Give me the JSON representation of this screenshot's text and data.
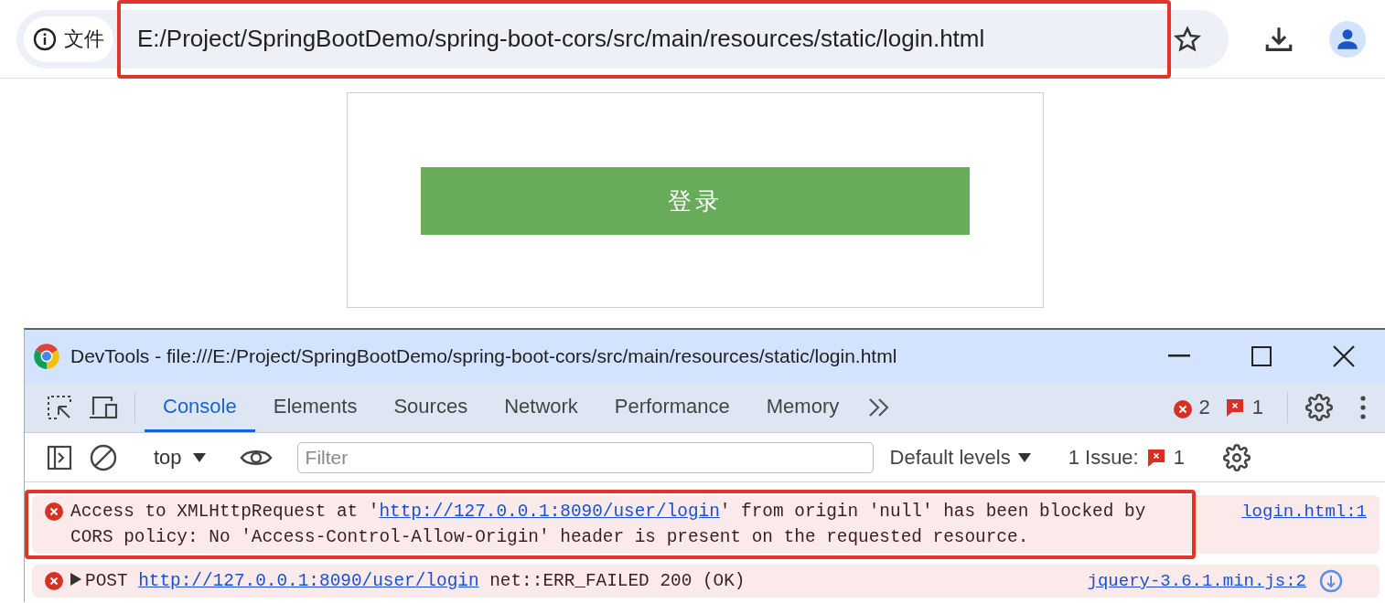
{
  "browser": {
    "site_label": "文件",
    "url": "E:/Project/SpringBootDemo/spring-boot-cors/src/main/resources/static/login.html",
    "url_highlighted": true
  },
  "page": {
    "login_button": "登录"
  },
  "devtools": {
    "title": "DevTools - file:///E:/Project/SpringBootDemo/spring-boot-cors/src/main/resources/static/login.html",
    "tabs": [
      {
        "label": "Console",
        "selected": true
      },
      {
        "label": "Elements",
        "selected": false
      },
      {
        "label": "Sources",
        "selected": false
      },
      {
        "label": "Network",
        "selected": false
      },
      {
        "label": "Performance",
        "selected": false
      },
      {
        "label": "Memory",
        "selected": false
      }
    ],
    "error_count": "2",
    "issue_count": "1",
    "console_toolbar": {
      "context": "top",
      "filter_placeholder": "Filter",
      "levels": "Default levels",
      "issues_label": "1 Issue:",
      "issues_count": "1"
    },
    "messages": [
      {
        "kind": "error",
        "expandable": false,
        "highlighted": true,
        "before": "Access to XMLHttpRequest at '",
        "url": "http://127.0.0.1:8090/user/login",
        "after": "' from origin 'null' has been blocked by CORS policy: No 'Access-Control-Allow-Origin' header is present on the requested resource.",
        "source": "login.html:1"
      },
      {
        "kind": "error",
        "expandable": true,
        "highlighted": false,
        "before": "POST ",
        "url": "http://127.0.0.1:8090/user/login",
        "after": " net::ERR_FAILED 200 (OK)",
        "source": "jquery-3.6.1.min.js:2"
      }
    ]
  }
}
